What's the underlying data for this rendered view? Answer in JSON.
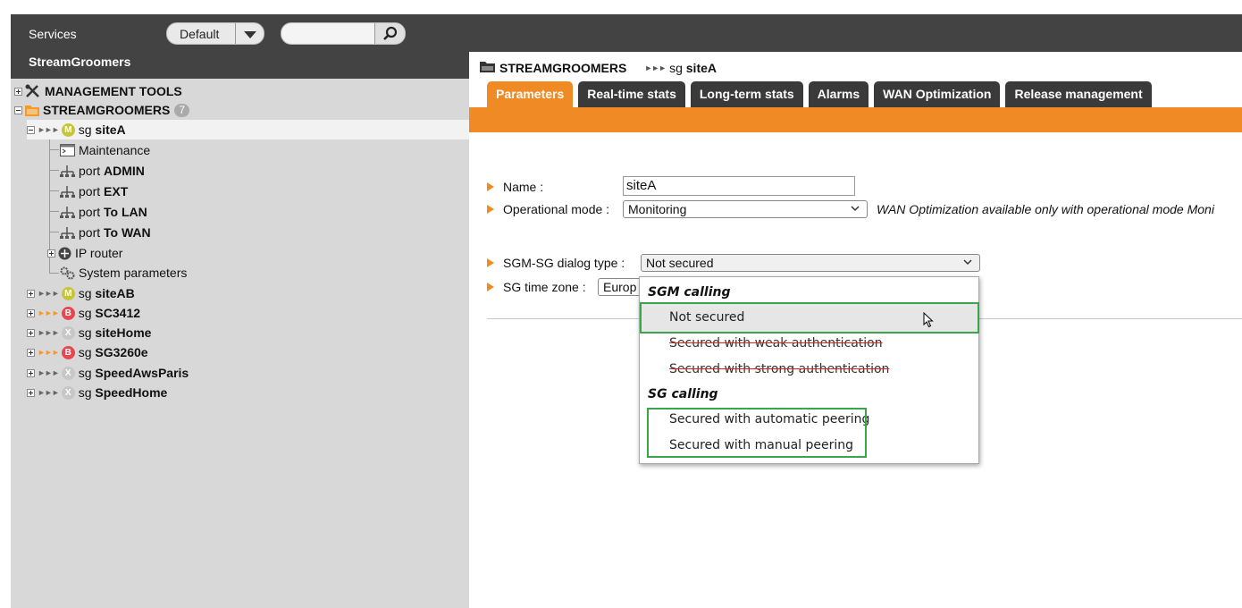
{
  "topbar": {
    "services_label": "Services",
    "profile_value": "Default",
    "search_placeholder": ""
  },
  "left_panel": {
    "title": "StreamGroomers",
    "tree": {
      "management_tools": "MANAGEMENT TOOLS",
      "streamgroomers": "STREAMGROOMERS",
      "streamgroomers_count": "7",
      "sg_prefix": "sg",
      "port_prefix": "port",
      "siteA": {
        "badge": "M",
        "name": "siteA"
      },
      "children": {
        "maintenance": "Maintenance",
        "port_admin": "ADMIN",
        "port_ext": "EXT",
        "port_to_lan": "To LAN",
        "port_to_wan": "To WAN",
        "ip_router": "IP router",
        "system_parameters": "System parameters"
      },
      "other_sites": [
        {
          "badge": "M",
          "name": "siteAB"
        },
        {
          "badge": "B",
          "name": "SC3412"
        },
        {
          "badge": "X",
          "name": "siteHome"
        },
        {
          "badge": "B",
          "name": "SG3260e"
        },
        {
          "badge": "X",
          "name": "SpeedAwsParis"
        },
        {
          "badge": "X",
          "name": "SpeedHome"
        }
      ]
    }
  },
  "breadcrumb": {
    "root": "STREAMGROOMERS",
    "current_prefix": "sg",
    "current": "siteA"
  },
  "tabs": [
    "Parameters",
    "Real-time stats",
    "Long-term stats",
    "Alarms",
    "WAN Optimization",
    "Release management"
  ],
  "active_tab": "Parameters",
  "form": {
    "name_label": "Name :",
    "name_value": "siteA",
    "opmode_label": "Operational mode :",
    "opmode_value": "Monitoring",
    "opmode_note": "WAN Optimization available only with operational mode Moni",
    "dialog_label": "SGM-SG dialog type :",
    "dialog_value": "Not secured",
    "timezone_label": "SG time zone :",
    "timezone_value": "Europ"
  },
  "dropdown": {
    "group1": "SGM calling",
    "opt_not_secured": "Not secured",
    "opt_weak": "Secured with weak authentication",
    "opt_strong": "Secured with strong authentication",
    "group2": "SG calling",
    "opt_auto": "Secured with automatic peering",
    "opt_manual": "Secured with manual peering"
  },
  "colors": {
    "accent_orange": "#f08a24",
    "dark_bar": "#434343",
    "highlight_green": "#3aa64a",
    "strike_red": "#dd2222"
  }
}
